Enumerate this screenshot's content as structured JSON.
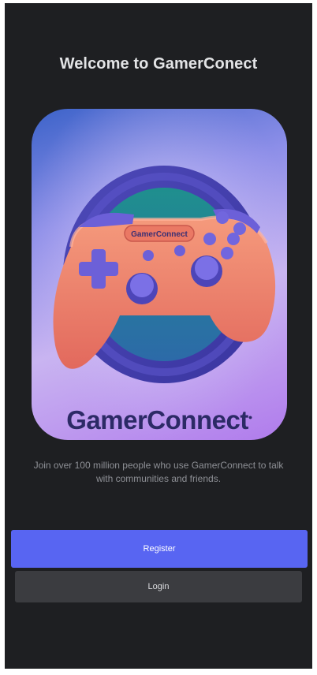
{
  "welcome": {
    "title": "Welcome to GamerConect"
  },
  "hero": {
    "brand": "GamerConnect",
    "controller_label": "GamerConnect"
  },
  "description": "Join over 100 million people who use GamerConnect to talk with communities and friends.",
  "buttons": {
    "register": "Register",
    "login": "Login"
  },
  "colors": {
    "background": "#1e1f22",
    "primary": "#5865f2",
    "secondary": "#3b3c40",
    "controller": "#f08667",
    "accent": "#6c60d8"
  },
  "icons": [
    "gamepad-icon",
    "dpad-icon",
    "joystick-icon",
    "button-icon"
  ]
}
